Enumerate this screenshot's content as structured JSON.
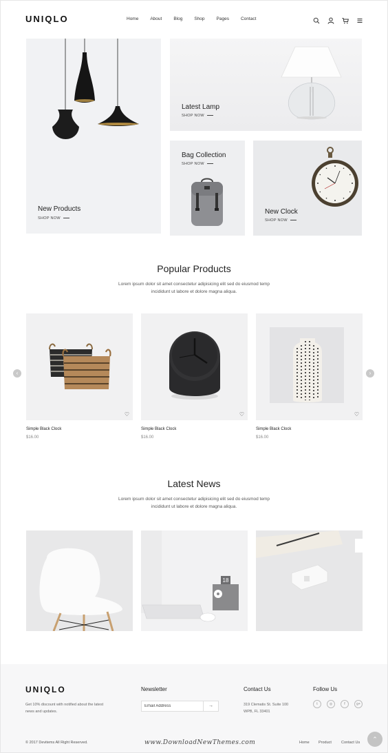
{
  "header": {
    "logo": "UNIQLO",
    "nav": [
      "Home",
      "About",
      "Blog",
      "Shop",
      "Pages",
      "Contact"
    ],
    "icons": [
      "search-icon",
      "user-icon",
      "cart-icon",
      "menu-icon"
    ]
  },
  "hero": {
    "new_products": {
      "title": "New Products",
      "link": "SHOP NOW"
    },
    "latest_lamp": {
      "title": "Latest Lamp",
      "link": "SHOP NOW"
    },
    "bag_collection": {
      "title": "Bag Collection",
      "link": "SHOP NOW"
    },
    "new_clock": {
      "title": "New Clock",
      "link": "SHOP NOW"
    }
  },
  "popular": {
    "title": "Popular Products",
    "desc": "Lorem ipsum dolor sit amet consectetur adipisicing elit sed do eiusmod temp incididunt ut labore et dolore magna aliqua.",
    "products": [
      {
        "name": "Simple Black Clock",
        "price": "$16.00"
      },
      {
        "name": "Simple Black Clock",
        "price": "$16.00"
      },
      {
        "name": "Simple Black Clock",
        "price": "$16.00"
      }
    ]
  },
  "news": {
    "title": "Latest News",
    "desc": "Lorem ipsum dolor sit amet consectetur adipisicing elit sed do eiusmod temp incididunt ut labore et dolore magna aliqua.",
    "calendar_number": "18"
  },
  "footer": {
    "logo": "UNIQLO",
    "about": "Get 10% discount with notified about the latest news and updates.",
    "newsletter_title": "Newsletter",
    "newsletter_placeholder": "Email Address",
    "contact_title": "Contact Us",
    "address": "319 Clematis St. Suite 100 WPB, FL 33401",
    "follow_title": "Follow Us",
    "social": [
      "twitter-icon",
      "instagram-icon",
      "facebook-icon",
      "google-plus-icon"
    ],
    "copyright": "© 2017 Devitems All Right Reserved.",
    "links": [
      "Home",
      "Product",
      "Contact Us"
    ],
    "watermark": "www.DownloadNewThemes.com"
  },
  "colors": {
    "tile_bg": "#f1f2f4",
    "footer_bg": "#f7f7f8",
    "arrow_bg": "#c9c9c9"
  }
}
